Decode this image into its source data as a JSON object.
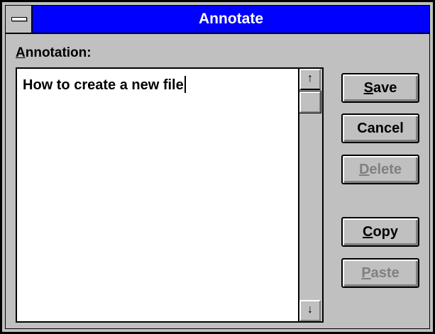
{
  "window": {
    "title": "Annotate"
  },
  "annotation": {
    "label_mnemonic": "A",
    "label_rest": "nnotation:",
    "text": "How to create a new file"
  },
  "scrollbar": {
    "up_glyph": "↑",
    "down_glyph": "↓"
  },
  "buttons": {
    "save": {
      "mnemonic": "S",
      "rest": "ave",
      "enabled": true
    },
    "cancel": {
      "label": "Cancel",
      "enabled": true
    },
    "delete": {
      "mnemonic": "D",
      "rest": "elete",
      "enabled": false
    },
    "copy": {
      "mnemonic": "C",
      "rest": "opy",
      "enabled": true
    },
    "paste": {
      "mnemonic": "P",
      "rest": "aste",
      "enabled": false
    }
  },
  "colors": {
    "titlebar": "#0000ff",
    "face": "#c0c0c0",
    "disabled_text": "#808080"
  }
}
